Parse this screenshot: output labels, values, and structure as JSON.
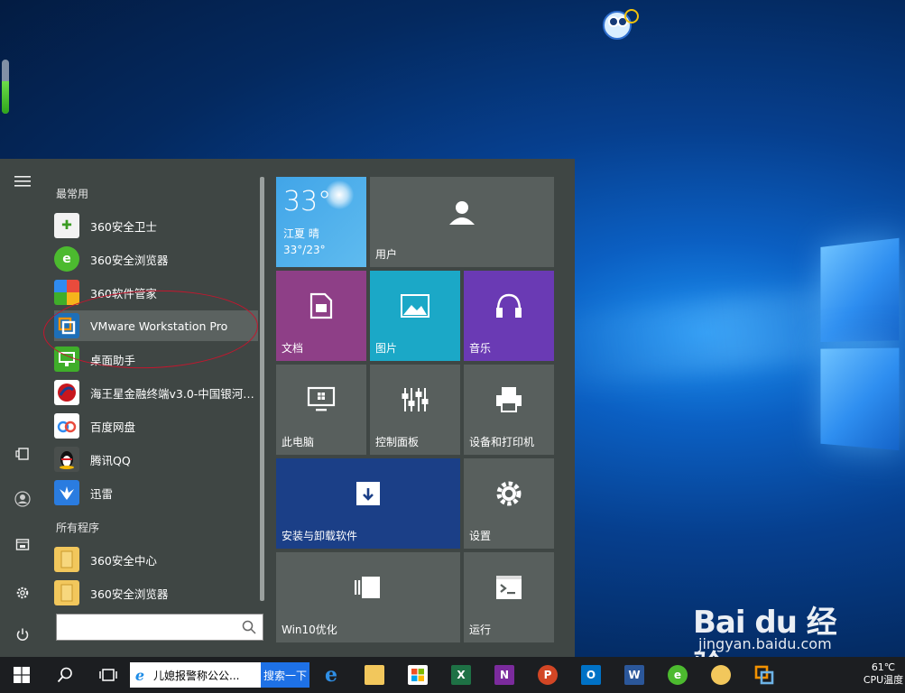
{
  "start_menu": {
    "section_frequent": "最常用",
    "section_all": "所有程序",
    "frequent_apps": [
      {
        "label": "360安全卫士",
        "icon": "shield-plus-icon",
        "color": "#45b035"
      },
      {
        "label": "360安全浏览器",
        "icon": "browser-e-icon",
        "color": "#3fae2a"
      },
      {
        "label": "360软件管家",
        "icon": "software-manager-icon",
        "color": "#e94b3c"
      },
      {
        "label": "VMware Workstation Pro",
        "icon": "vmware-icon",
        "color": "#f39200"
      },
      {
        "label": "桌面助手",
        "icon": "desktop-assistant-icon",
        "color": "#3fae2a"
      },
      {
        "label": "海王星金融终端v3.0-中国银河证...",
        "icon": "finance-terminal-icon",
        "color": "#c8171e"
      },
      {
        "label": "百度网盘",
        "icon": "cloud-drive-icon",
        "color": "#2f8bf0"
      },
      {
        "label": "腾讯QQ",
        "icon": "qq-penguin-icon",
        "color": "#111111"
      },
      {
        "label": "迅雷",
        "icon": "thunder-bird-icon",
        "color": "#2a7ce0"
      }
    ],
    "all_apps": [
      {
        "label": "360安全中心",
        "icon": "folder-icon"
      },
      {
        "label": "360安全浏览器",
        "icon": "folder-icon"
      }
    ],
    "search_value": ""
  },
  "tiles": {
    "weather": {
      "temp": "33°",
      "city": "江夏 晴",
      "range": "33°/23°"
    },
    "user": "用户",
    "documents": "文档",
    "pictures": "图片",
    "music": "音乐",
    "this_pc": "此电脑",
    "control_panel": "控制面板",
    "devices": "设备和打印机",
    "uninstall": "安装与卸载软件",
    "settings": "设置",
    "win10opt": "Win10优化",
    "run": "运行"
  },
  "taskbar": {
    "search_query": "儿媳报警称公公...",
    "search_button": "搜索一下",
    "tray_temp": "61℃",
    "tray_cpu": "CPU温度"
  },
  "desktop": {
    "gauge_level": 0.6
  },
  "watermark": {
    "logo": "Bai du 经验",
    "url": "jingyan.baidu.com"
  }
}
